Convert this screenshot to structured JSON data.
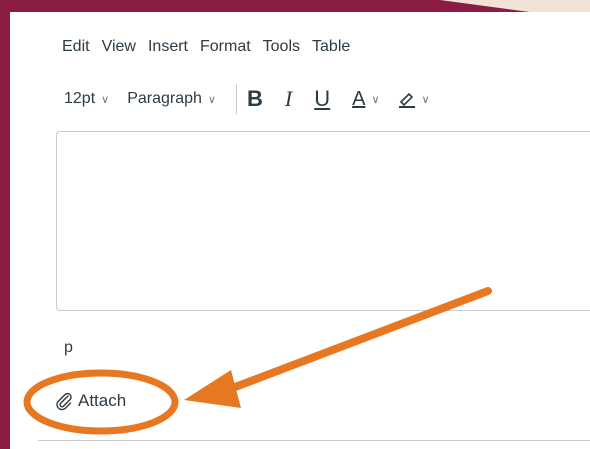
{
  "menu": {
    "edit": "Edit",
    "view": "View",
    "insert": "Insert",
    "format": "Format",
    "tools": "Tools",
    "table": "Table"
  },
  "toolbar": {
    "font_size": "12pt",
    "block_format": "Paragraph",
    "bold": "B",
    "italic": "I",
    "underline": "U",
    "text_color": "A",
    "highlight_icon": "highlighter-icon"
  },
  "editor": {
    "path": "p"
  },
  "attach": {
    "label": "Attach",
    "icon": "paperclip-icon"
  },
  "colors": {
    "frame": "#8b1c43",
    "annotation": "#e87722",
    "text": "#2d3b45"
  }
}
